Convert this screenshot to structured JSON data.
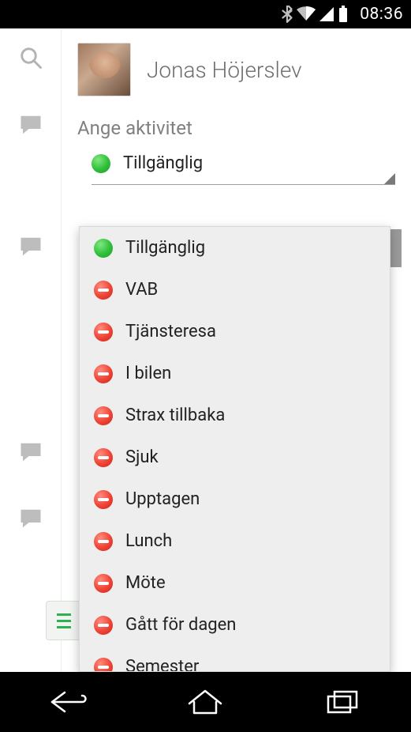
{
  "status_bar": {
    "time": "08:36",
    "icons": [
      "bluetooth",
      "wifi",
      "signal",
      "battery"
    ]
  },
  "left_rail": {
    "items": [
      {
        "icon": "search"
      },
      {
        "icon": "chat"
      },
      {
        "icon": "chat"
      },
      {
        "icon": "chat"
      },
      {
        "icon": "chat"
      }
    ]
  },
  "profile": {
    "name": "Jonas Höjerslev"
  },
  "section_title": "Ange aktivitet",
  "selected_status": {
    "label": "Tillgänglig",
    "color": "green"
  },
  "dropdown": {
    "options": [
      {
        "label": "Tillgänglig",
        "color": "green"
      },
      {
        "label": "VAB",
        "color": "red"
      },
      {
        "label": "Tjänsteresa",
        "color": "red"
      },
      {
        "label": "I bilen",
        "color": "red"
      },
      {
        "label": "Strax tillbaka",
        "color": "red"
      },
      {
        "label": "Sjuk",
        "color": "red"
      },
      {
        "label": "Upptagen",
        "color": "red"
      },
      {
        "label": "Lunch",
        "color": "red"
      },
      {
        "label": "Möte",
        "color": "red"
      },
      {
        "label": "Gått för dagen",
        "color": "red"
      },
      {
        "label": "Semester",
        "color": "red"
      }
    ]
  }
}
